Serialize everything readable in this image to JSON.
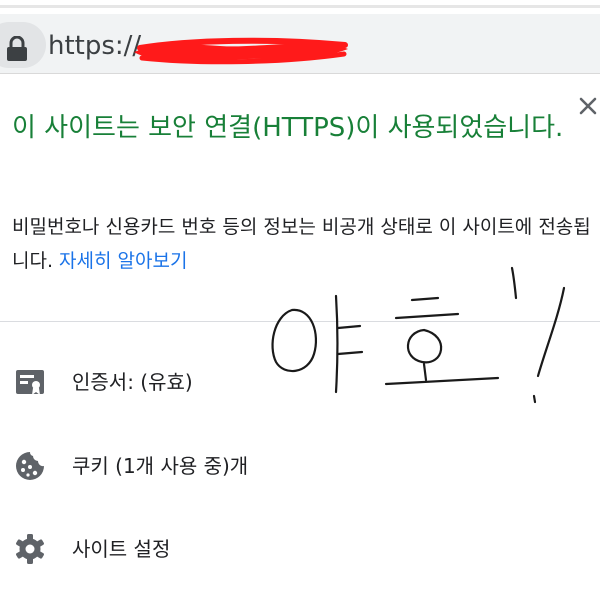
{
  "address_bar": {
    "url_prefix": "https://",
    "lock_icon": "lock-icon",
    "redaction_color": "#ff1a1a"
  },
  "popup": {
    "close_icon": "close-icon",
    "title": "이 사이트는 보안 연결(HTTPS)이 사용되었습니다.",
    "description": "비밀번호나 신용카드 번호 등의 정보는 비공개 상태로 이 사이트에 전송됩니다. ",
    "learn_more_link": "자세히 알아보기",
    "title_color": "#188038",
    "link_color": "#1a73e8"
  },
  "menu": {
    "items": [
      {
        "label": "인증서: (유효)",
        "icon": "certificate-icon"
      },
      {
        "label": "쿠키 (1개 사용 중)개",
        "icon": "cookie-icon"
      },
      {
        "label": "사이트 설정",
        "icon": "gear-icon"
      }
    ]
  },
  "handwriting": {
    "icon": "handwritten-doodle"
  }
}
